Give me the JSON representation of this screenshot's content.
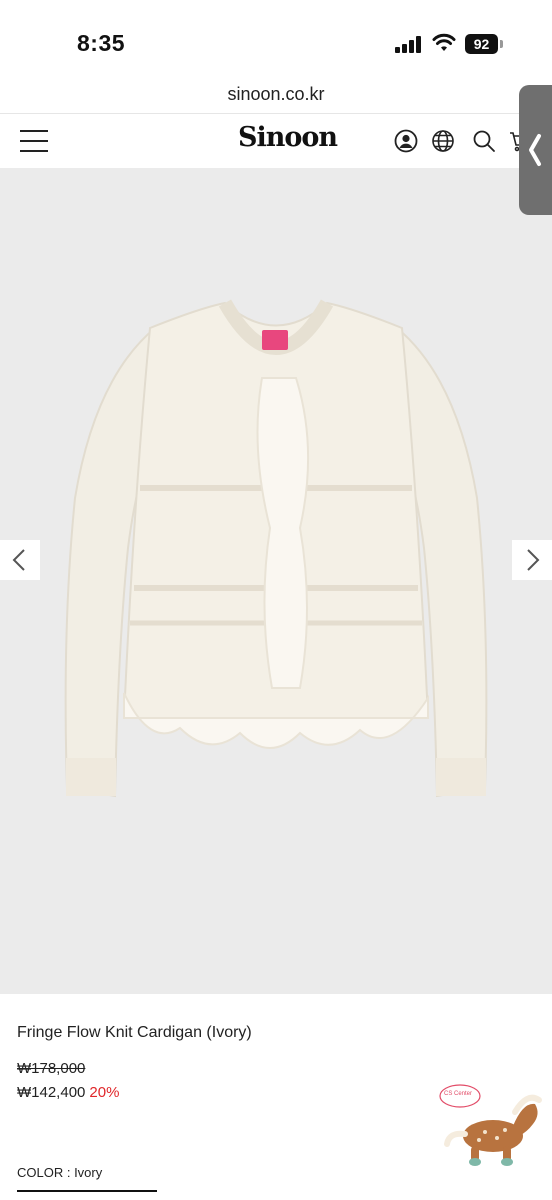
{
  "status_bar": {
    "time": "8:35",
    "battery": "92"
  },
  "browser": {
    "url": "sinoon.co.kr"
  },
  "header": {
    "logo": "Sinoon"
  },
  "product": {
    "name": "Fringe Flow Knit Cardigan (Ivory)",
    "original_price": "₩178,000",
    "sale_price": "₩142,400",
    "discount": "20%",
    "color_label": "COLOR : Ivory",
    "label_tag": "Sinoon"
  },
  "cs_widget": {
    "label": "CS Center"
  },
  "colors": {
    "discount_red": "#e0262a",
    "gallery_bg": "#ebebeb",
    "side_tab": "#6f6f6f"
  },
  "icons": [
    "menu-icon",
    "account-icon",
    "globe-icon",
    "search-icon",
    "cart-icon",
    "chevron-left-icon",
    "chevron-right-icon"
  ]
}
